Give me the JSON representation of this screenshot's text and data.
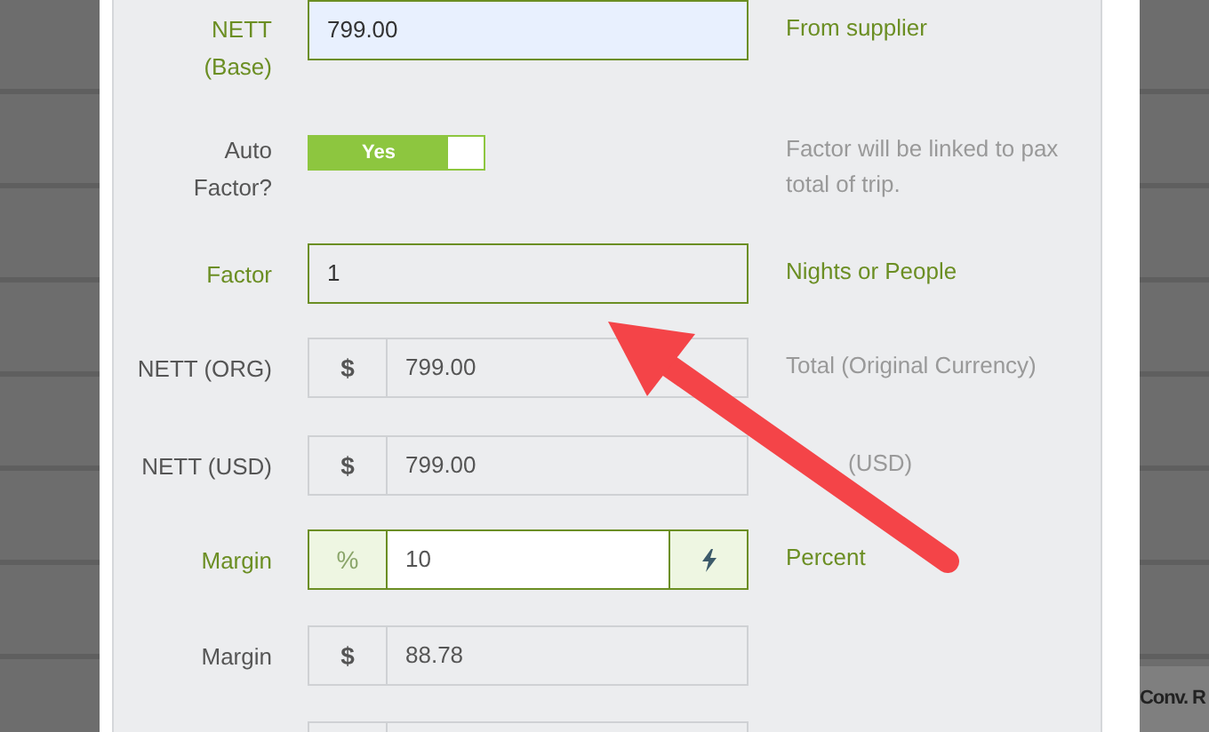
{
  "form": {
    "rows": [
      {
        "kind": "text",
        "label": "NETT (Base)",
        "highlighted": true,
        "value": "799.00",
        "autofilled": true,
        "help": "From supplier"
      },
      {
        "kind": "toggle",
        "label": "Auto Factor?",
        "highlighted": false,
        "on": true,
        "toggle_label": "Yes",
        "help": "Factor will be linked to pax total of trip."
      },
      {
        "kind": "text",
        "label": "Factor",
        "highlighted": true,
        "value": "1",
        "autofilled": false,
        "help": "Nights or People"
      },
      {
        "kind": "addon",
        "label": "NETT (ORG)",
        "highlighted": false,
        "prefix": "$",
        "value": "799.00",
        "suffix_icon": false,
        "help": "Total (Original Currency)"
      },
      {
        "kind": "addon",
        "label": "NETT (USD)",
        "highlighted": false,
        "prefix": "$",
        "value": "799.00",
        "suffix_icon": false,
        "help": "(USD)",
        "help_covered": true
      },
      {
        "kind": "addon",
        "label": "Margin",
        "highlighted": true,
        "editable": true,
        "prefix": "%",
        "value": "10",
        "suffix_icon": true,
        "help": "Percent"
      },
      {
        "kind": "addon",
        "label": "Margin",
        "highlighted": false,
        "prefix": "$",
        "value": "88.78",
        "suffix_icon": false
      },
      {
        "kind": "addon",
        "highlighted": false,
        "suffix_icon": false
      }
    ]
  },
  "backdrop": {
    "column_header": "Conv. R"
  }
}
